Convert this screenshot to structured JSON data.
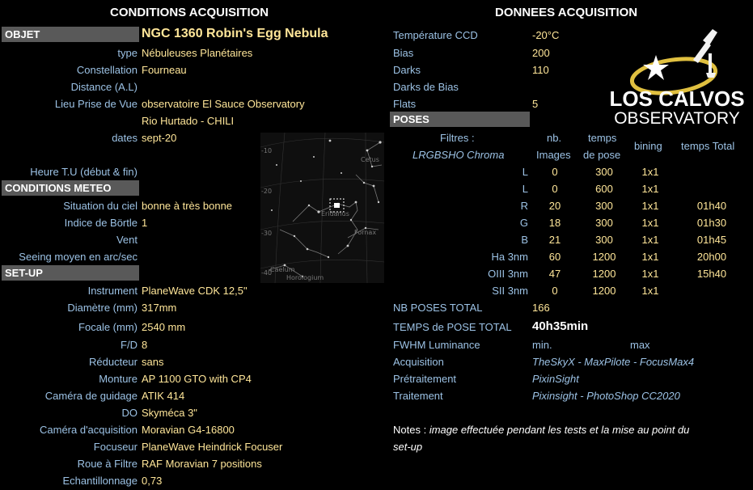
{
  "headers": {
    "left": "CONDITIONS ACQUISITION",
    "right": "DONNEES ACQUISITION"
  },
  "sections": {
    "objet": "OBJET",
    "meteo": "CONDITIONS METEO",
    "setup": "SET-UP",
    "poses": "POSES"
  },
  "object_title": "NGC 1360 Robin's Egg Nebula",
  "left_rows": [
    {
      "label": "type",
      "value": "Nébuleuses Planétaires"
    },
    {
      "label": "Constellation",
      "value": "Fourneau"
    },
    {
      "label": "Distance (A.L)",
      "value": ""
    },
    {
      "label": "Lieu Prise de Vue",
      "value": "observatoire El Sauce Observatory"
    },
    {
      "label": "",
      "value": "Rio Hurtado - CHILI"
    },
    {
      "label": "dates",
      "value": "sept-20"
    },
    {
      "label": "Heure T.U (début & fin)",
      "value": ""
    }
  ],
  "meteo_rows": [
    {
      "label": "Situation du ciel",
      "value": "bonne à très bonne"
    },
    {
      "label": "Indice de Börtle",
      "value": "1"
    },
    {
      "label": "Vent",
      "value": ""
    },
    {
      "label": "Seeing moyen en arc/sec",
      "value": ""
    }
  ],
  "setup_rows": [
    {
      "label": "Instrument",
      "value": "PlaneWave CDK 12,5\""
    },
    {
      "label": "Diamètre (mm)",
      "value": "317mm"
    },
    {
      "label": "Focale (mm)",
      "value": "2540 mm"
    },
    {
      "label": "F/D",
      "value": "8"
    },
    {
      "label": "Réducteur",
      "value": "sans"
    },
    {
      "label": "Monture",
      "value": "AP 1100 GTO with CP4"
    },
    {
      "label": "Caméra de guidage",
      "value": "ATIK 414"
    },
    {
      "label": "DO",
      "value": "Skyméca 3\""
    },
    {
      "label": "Caméra d'acquisition",
      "value": "Moravian G4-16800"
    },
    {
      "label": "Focuseur",
      "value": "PlaneWave Heindrick Focuser"
    },
    {
      "label": "Roue à Filtre",
      "value": "RAF Moravian 7 positions"
    },
    {
      "label": "Echantillonnage",
      "value": "0,73"
    }
  ],
  "donnees_rows": [
    {
      "label": "Température CCD",
      "value": "-20°C"
    },
    {
      "label": "Bias",
      "value": "200"
    },
    {
      "label": "Darks",
      "value": "110"
    },
    {
      "label": "Darks de Bias",
      "value": ""
    },
    {
      "label": "Flats",
      "value": "5"
    }
  ],
  "poses_header": {
    "filtres": "Filtres :",
    "filtres_sub": "LRGBSHO Chroma",
    "nb": "nb.",
    "images": "Images",
    "temps": "temps",
    "de_pose": "de pose",
    "bining": "bining",
    "total": "temps Total"
  },
  "poses_rows": [
    {
      "filter": "L",
      "nb": "0",
      "temps": "300",
      "bin": "1x1",
      "total": ""
    },
    {
      "filter": "L",
      "nb": "0",
      "temps": "600",
      "bin": "1x1",
      "total": ""
    },
    {
      "filter": "R",
      "nb": "20",
      "temps": "300",
      "bin": "1x1",
      "total": "01h40"
    },
    {
      "filter": "G",
      "nb": "18",
      "temps": "300",
      "bin": "1x1",
      "total": "01h30"
    },
    {
      "filter": "B",
      "nb": "21",
      "temps": "300",
      "bin": "1x1",
      "total": "01h45"
    },
    {
      "filter": "Ha 3nm",
      "nb": "60",
      "temps": "1200",
      "bin": "1x1",
      "total": "20h00"
    },
    {
      "filter": "OIII 3nm",
      "nb": "47",
      "temps": "1200",
      "bin": "1x1",
      "total": "15h40"
    },
    {
      "filter": "SII 3nm",
      "nb": "0",
      "temps": "1200",
      "bin": "1x1",
      "total": ""
    }
  ],
  "totals": {
    "nb_label": "NB POSES TOTAL",
    "nb_value": "166",
    "temps_label": "TEMPS de POSE TOTAL",
    "temps_value": "40h35min"
  },
  "fwhm": {
    "label": "FWHM Luminance",
    "min": "min.",
    "max": "max"
  },
  "software": [
    {
      "label": "Acquisition",
      "value": "TheSkyX - MaxPilote - FocusMax4"
    },
    {
      "label": "Prétraitement",
      "value": "PixinSight"
    },
    {
      "label": "Traitement",
      "value": "Pixinsight - PhotoShop CC2020"
    }
  ],
  "notes": {
    "label": "Notes :",
    "line1": "image effectuée pendant les tests et la mise au point du",
    "line2": "set-up"
  },
  "logo": {
    "line1": "LOS CALVOS",
    "line2": "OBSERVATORY"
  },
  "starmap": {
    "labels": {
      "cetus": "Cetus",
      "eridanus": "Eridanus",
      "fornax": "Fornax",
      "caelum": "Caelum",
      "horologium": "Horologium"
    },
    "ticks": [
      "-10",
      "-20",
      "-30",
      "-40"
    ]
  },
  "colors": {
    "label": "#9cc2e5",
    "value": "#ffe699",
    "section_bg": "#595959"
  }
}
